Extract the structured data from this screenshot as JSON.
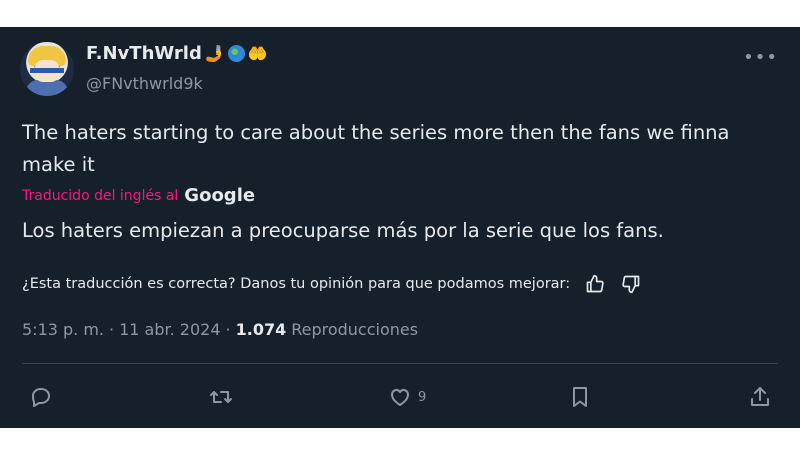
{
  "author": {
    "display_name": "F.NvThWrld",
    "handle": "@FNvthwrld9k",
    "name_emojis": [
      "🤳",
      "globe",
      "🤲"
    ]
  },
  "tweet": {
    "text": "The haters starting to care about the series more then the fans we finna make it",
    "translated_by_label": "Traducido del inglés al",
    "translator_brand": "Google",
    "translation": "Los haters empiezan a preocuparse más por la serie que los fans.",
    "feedback_prompt": "¿Esta traducción es correcta? Danos tu opinión para que podamos mejorar:",
    "time": "5:13 p. m.",
    "date": "11 abr. 2024",
    "separator": "·",
    "views_count": "1.074",
    "views_label": "Reproducciones"
  },
  "actions": {
    "reply_icon": "reply-icon",
    "repost_icon": "repost-icon",
    "like_icon": "heart-icon",
    "like_count": "9",
    "bookmark_icon": "bookmark-icon",
    "share_icon": "share-icon"
  },
  "colors": {
    "background": "#15202b",
    "text": "#e7e9ea",
    "muted": "#8b98a5",
    "accent_pink": "#f91880"
  }
}
